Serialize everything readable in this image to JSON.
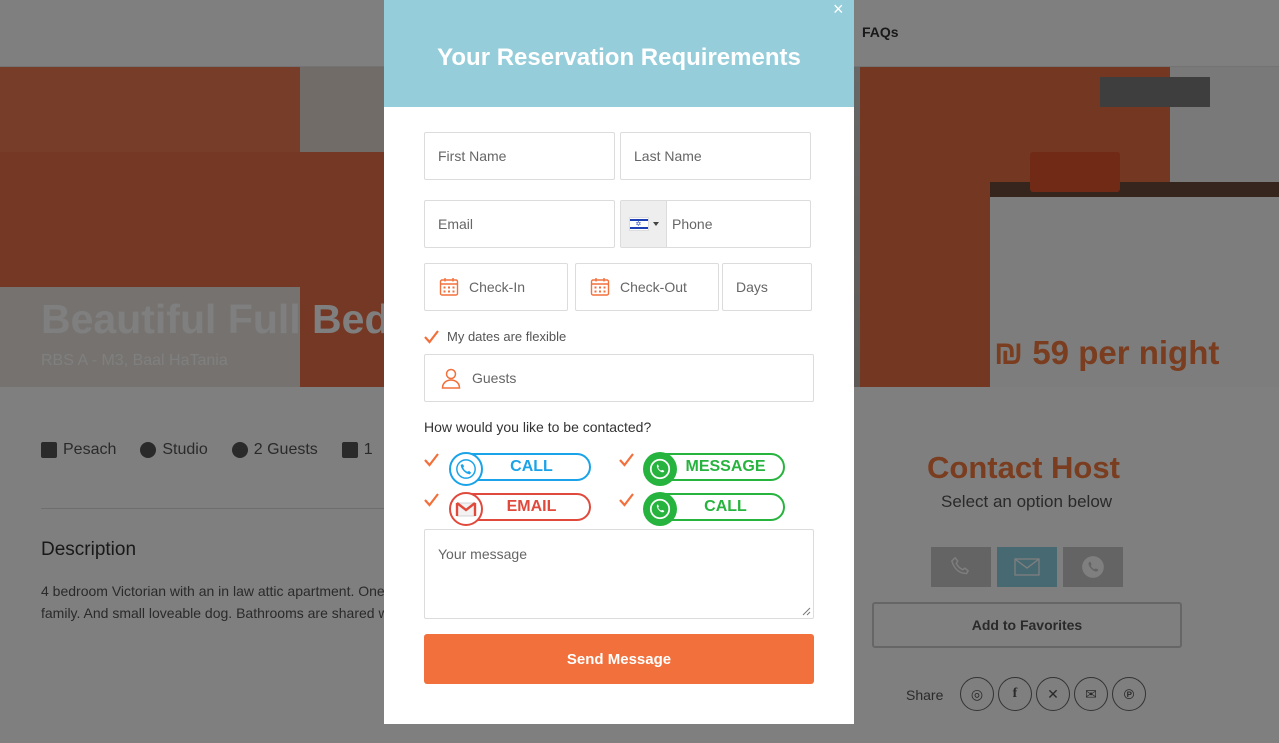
{
  "nav": {
    "faqs_label": "FAQs"
  },
  "hero": {
    "title": "Beautiful Full Bed",
    "subtitle": "RBS A - M3, Baal HaTania",
    "price": "₪ 59 per night"
  },
  "features": [
    {
      "icon": "building-icon",
      "label": "Pesach"
    },
    {
      "icon": "thumbs-up-icon",
      "label": "Studio"
    },
    {
      "icon": "users-icon",
      "label": "2 Guests"
    },
    {
      "icon": "bed-icon",
      "label": "1"
    }
  ],
  "description": {
    "heading": "Description",
    "line1": "4 bedroom Victorian with an in law attic apartment. One",
    "line2": "family. And small loveable dog. Bathrooms are shared w"
  },
  "contact": {
    "heading": "Contact Host",
    "subheading": "Select an option below",
    "favorites_label": "Add to Favorites",
    "share_label": "Share",
    "share_icons": [
      "whatsapp-icon",
      "facebook-icon",
      "x-icon",
      "email-icon",
      "pinterest-icon"
    ]
  },
  "modal": {
    "title": "Your Reservation Requirements",
    "close_label": "×",
    "first_name_placeholder": "First Name",
    "last_name_placeholder": "Last Name",
    "email_placeholder": "Email",
    "phone_placeholder": "Phone",
    "phone_country": "IL",
    "checkin_placeholder": "Check-In",
    "checkout_placeholder": "Check-Out",
    "days_placeholder": "Days",
    "flexible_label": "My dates are flexible",
    "flexible_checked": true,
    "guests_placeholder": "Guests",
    "contact_question": "How would you like to be contacted?",
    "contact_options": [
      {
        "label": "CALL",
        "color": "#1aa3e8",
        "icon": "phone-icon",
        "checked": true
      },
      {
        "label": "MESSAGE",
        "color": "#27b43e",
        "icon": "whatsapp-icon",
        "checked": true
      },
      {
        "label": "EMAIL",
        "color": "#e04a3c",
        "icon": "gmail-icon",
        "checked": true
      },
      {
        "label": "CALL",
        "color": "#27b43e",
        "icon": "whatsapp-icon",
        "checked": true
      }
    ],
    "message_placeholder": "Your message",
    "send_label": "Send Message"
  },
  "colors": {
    "accent": "#f2703b",
    "header": "#96cddb",
    "check": "#f2703b"
  }
}
